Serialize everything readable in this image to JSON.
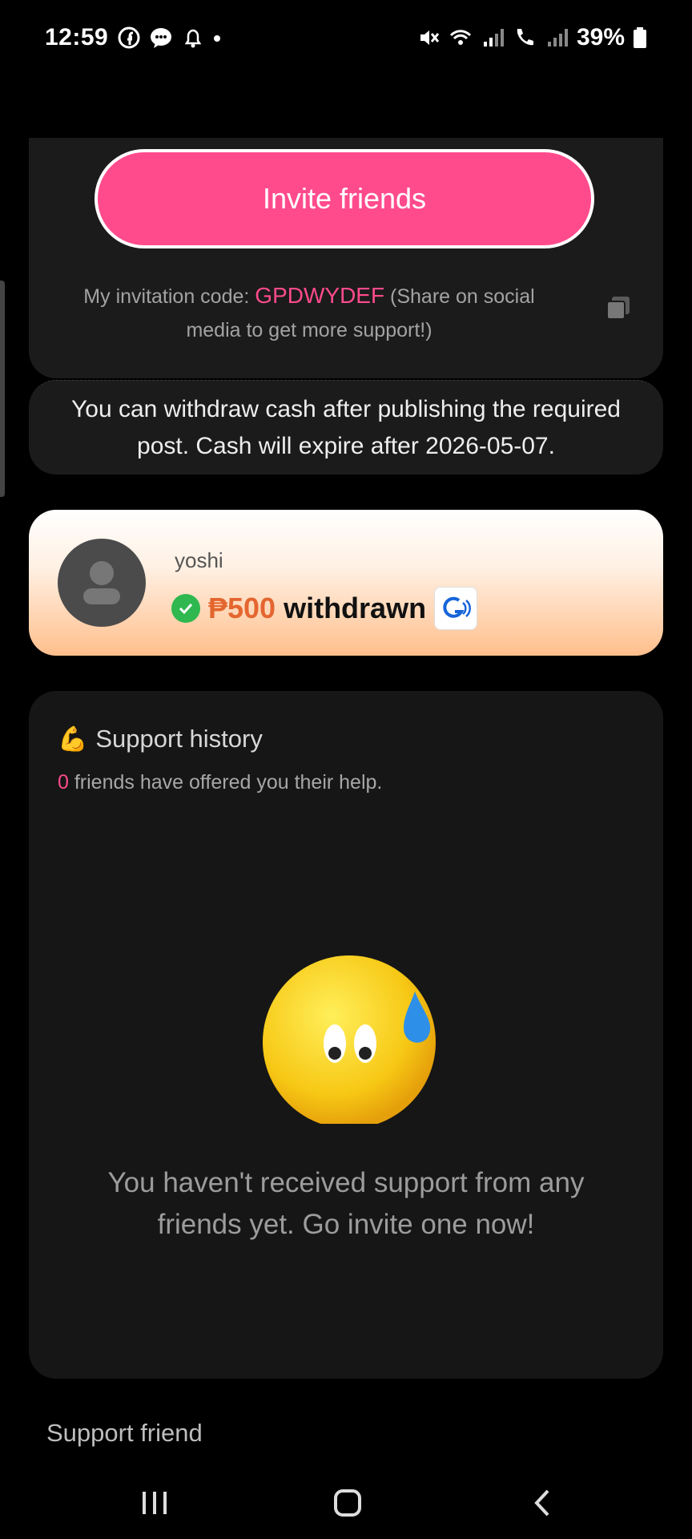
{
  "status_bar": {
    "time": "12:59",
    "battery": "39%"
  },
  "invite": {
    "button_label": "Invite friends",
    "code_prefix": "My invitation code: ",
    "code": "GPDWYDEF",
    "code_suffix": " (Share on social media to get more support!)"
  },
  "notice": {
    "text": "You can withdraw cash after publishing the required post. Cash will expire after 2026-05-07."
  },
  "withdraw_card": {
    "username": "yoshi",
    "amount": "₱500",
    "status": "withdrawn"
  },
  "history": {
    "title": "Support history",
    "count": "0",
    "subtitle": " friends have offered you their help.",
    "empty_text": "You haven't received support from any friends yet. Go invite one now!"
  },
  "support_friend_label": "Support friend",
  "colors": {
    "accent": "#ff4b8c",
    "amount": "#e4662f",
    "card_bg": "#1b1b1b"
  }
}
